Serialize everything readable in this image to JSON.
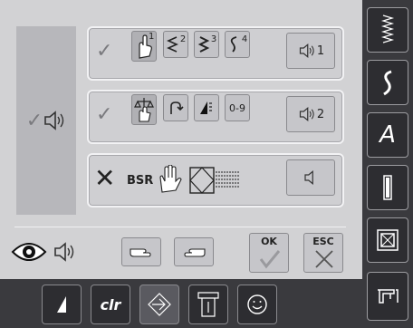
{
  "rows": [
    {
      "state_icon": "check-icon",
      "stitch_labels": [
        "1",
        "2",
        "3",
        "4"
      ],
      "speaker_label": "1"
    },
    {
      "state_icon": "check-icon",
      "mode_labels": [
        "",
        "",
        "",
        "0-9"
      ],
      "speaker_label": "2"
    },
    {
      "state_icon": "cross-icon",
      "bsr_label": "BSR"
    }
  ],
  "buttons": {
    "ok_label": "OK",
    "esc_label": "ESC",
    "clr_label": "clr"
  },
  "colors": {
    "panel": "#d2d2d4",
    "frame": "#3a3a3e",
    "button": "#c6c6ca",
    "dark_button": "#2d2d31"
  }
}
